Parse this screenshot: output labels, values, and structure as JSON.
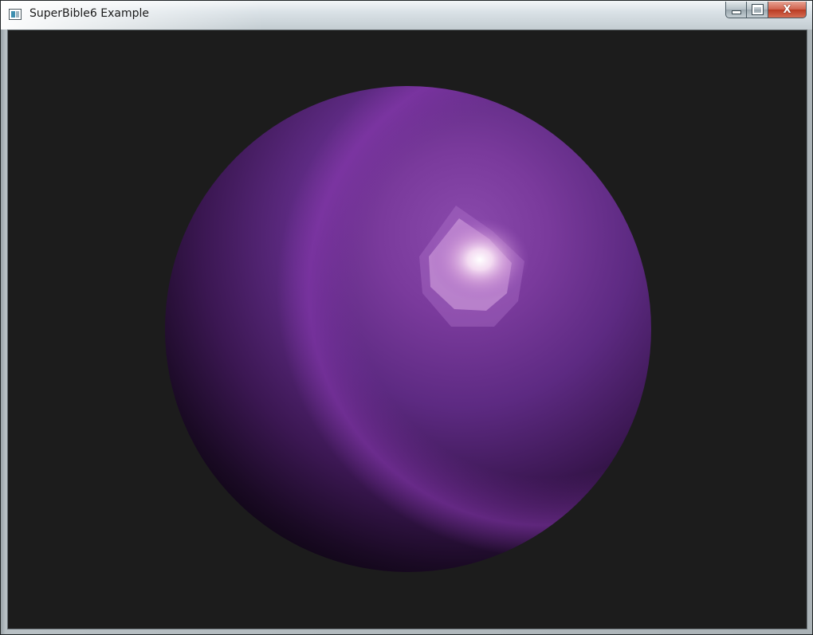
{
  "window": {
    "title": "SuperBible6 Example",
    "icon": "application-window-icon"
  },
  "caption_buttons": {
    "minimize_icon": "minimize-icon",
    "maximize_icon": "maximize-icon",
    "close_icon": "close-icon",
    "close_glyph": "X"
  },
  "scene": {
    "background_color": "#1c1c1c",
    "object": "sphere",
    "sphere_color": "#7b2ea0",
    "highlight_color": "#f4e6f6"
  }
}
